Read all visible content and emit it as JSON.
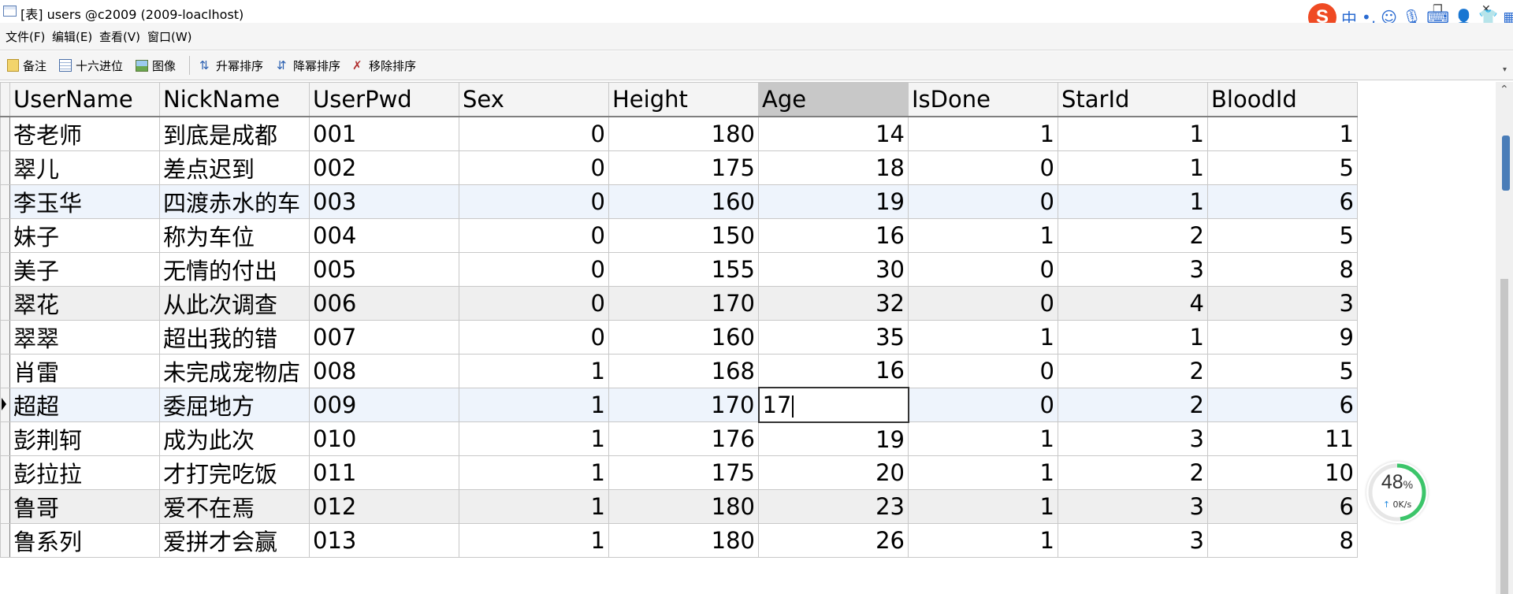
{
  "window": {
    "title": "[表] users @c2009 (2009-loaclhost)"
  },
  "menu": [
    "文件(F)",
    "编辑(E)",
    "查看(V)",
    "窗口(W)"
  ],
  "toolbar": {
    "memo": "备注",
    "hex": "十六进位",
    "image": "图像",
    "sort_asc": "升幂排序",
    "sort_desc": "降幂排序",
    "remove_sort": "移除排序"
  },
  "ime": {
    "logo": "S",
    "lang": "中",
    "punct": "•,"
  },
  "table": {
    "columns": [
      "UserName",
      "NickName",
      "UserPwd",
      "Sex",
      "Height",
      "Age",
      "IsDone",
      "StarId",
      "BloodId"
    ],
    "sorted_column": "Age",
    "rows": [
      [
        "苍老师",
        "到底是成都",
        "001",
        "0",
        "180",
        "14",
        "1",
        "1",
        "1"
      ],
      [
        "翠儿",
        "差点迟到",
        "002",
        "0",
        "175",
        "18",
        "0",
        "1",
        "5"
      ],
      [
        "李玉华",
        "四渡赤水的车",
        "003",
        "0",
        "160",
        "19",
        "0",
        "1",
        "6"
      ],
      [
        "妹子",
        "称为车位",
        "004",
        "0",
        "150",
        "16",
        "1",
        "2",
        "5"
      ],
      [
        "美子",
        "无情的付出",
        "005",
        "0",
        "155",
        "30",
        "0",
        "3",
        "8"
      ],
      [
        "翠花",
        "从此次调查",
        "006",
        "0",
        "170",
        "32",
        "0",
        "4",
        "3"
      ],
      [
        "翠翠",
        "超出我的错",
        "007",
        "0",
        "160",
        "35",
        "1",
        "1",
        "9"
      ],
      [
        "肖雷",
        "未完成宠物店",
        "008",
        "1",
        "168",
        "16",
        "0",
        "2",
        "5"
      ],
      [
        "超超",
        "委屈地方",
        "009",
        "1",
        "170",
        "17",
        "0",
        "2",
        "6"
      ],
      [
        "彭荆轲",
        "成为此次",
        "010",
        "1",
        "176",
        "19",
        "1",
        "3",
        "11"
      ],
      [
        "彭拉拉",
        "才打完吃饭",
        "011",
        "1",
        "175",
        "20",
        "1",
        "2",
        "10"
      ],
      [
        "鲁哥",
        "爱不在焉",
        "012",
        "1",
        "180",
        "23",
        "1",
        "3",
        "6"
      ],
      [
        "鲁系列",
        "爱拼才会赢",
        "013",
        "1",
        "180",
        "26",
        "1",
        "3",
        "8"
      ]
    ],
    "editing_row": 8,
    "editing_column": 5
  },
  "net_monitor": {
    "percent": "48",
    "percent_unit": "%",
    "rate": "0K/s",
    "percent_value": 48
  },
  "colors": {
    "sogou": "#ef4a23",
    "row_highlight": "#eef4fc",
    "sorted_header": "#c8c8c8"
  }
}
